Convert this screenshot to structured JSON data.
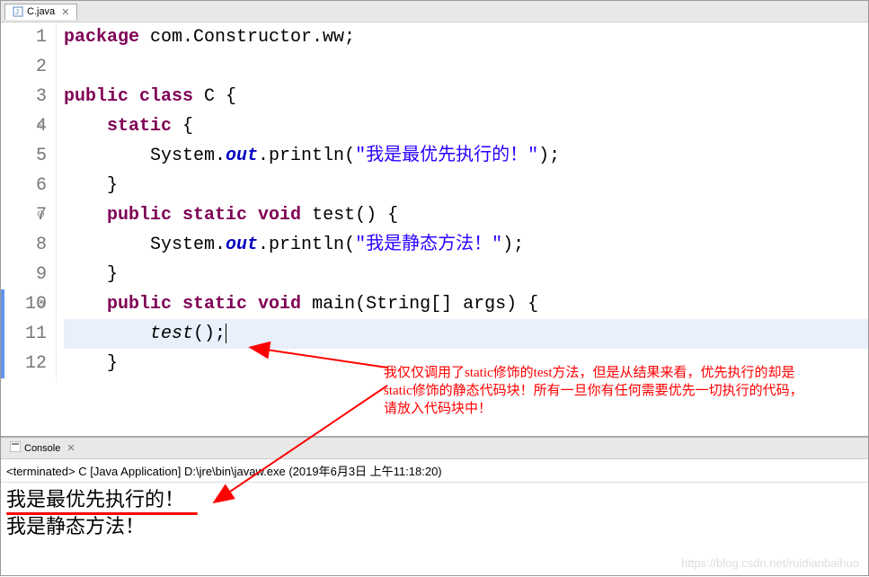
{
  "tab": {
    "filename": "C.java",
    "close": "✕"
  },
  "code": {
    "lines": [
      {
        "n": "1",
        "tokens": [
          {
            "t": "package ",
            "c": "kw"
          },
          {
            "t": "com.Constructor.ww;",
            "c": "txt"
          }
        ]
      },
      {
        "n": "2",
        "tokens": []
      },
      {
        "n": "3",
        "tokens": [
          {
            "t": "public class ",
            "c": "kw"
          },
          {
            "t": "C {",
            "c": "txt"
          }
        ]
      },
      {
        "n": "4",
        "fold": true,
        "tokens": [
          {
            "t": "    ",
            "c": "txt"
          },
          {
            "t": "static",
            "c": "kw"
          },
          {
            "t": " {",
            "c": "txt"
          }
        ]
      },
      {
        "n": "5",
        "tokens": [
          {
            "t": "        System.",
            "c": "txt"
          },
          {
            "t": "out",
            "c": "static-field"
          },
          {
            "t": ".println(",
            "c": "txt"
          },
          {
            "t": "\"我是最优先执行的！\"",
            "c": "str"
          },
          {
            "t": ");",
            "c": "txt"
          }
        ]
      },
      {
        "n": "6",
        "tokens": [
          {
            "t": "    }",
            "c": "txt"
          }
        ]
      },
      {
        "n": "7",
        "fold": true,
        "tokens": [
          {
            "t": "    ",
            "c": "txt"
          },
          {
            "t": "public static void",
            "c": "kw"
          },
          {
            "t": " test() {",
            "c": "txt"
          }
        ]
      },
      {
        "n": "8",
        "tokens": [
          {
            "t": "        System.",
            "c": "txt"
          },
          {
            "t": "out",
            "c": "static-field"
          },
          {
            "t": ".println(",
            "c": "txt"
          },
          {
            "t": "\"我是静态方法！\"",
            "c": "str"
          },
          {
            "t": ");",
            "c": "txt"
          }
        ]
      },
      {
        "n": "9",
        "tokens": [
          {
            "t": "    }",
            "c": "txt"
          }
        ]
      },
      {
        "n": "10",
        "fold": true,
        "hl": true,
        "tokens": [
          {
            "t": "    ",
            "c": "txt"
          },
          {
            "t": "public static void",
            "c": "kw"
          },
          {
            "t": " main(String[] args) {",
            "c": "txt"
          }
        ]
      },
      {
        "n": "11",
        "current": true,
        "hl": true,
        "tokens": [
          {
            "t": "        ",
            "c": "txt"
          },
          {
            "t": "test",
            "c": "method-call"
          },
          {
            "t": "();",
            "c": "txt"
          }
        ],
        "cursor": true
      },
      {
        "n": "12",
        "hl": true,
        "tokens": [
          {
            "t": "    }",
            "c": "txt"
          }
        ]
      }
    ]
  },
  "annotation": {
    "text": "我仅仅调用了static修饰的test方法，但是从结果来看，优先执行的却是static修饰的静态代码块！所有一旦你有任何需要优先一切执行的代码，请放入代码块中！"
  },
  "console": {
    "title": "Console",
    "close": "✕",
    "status": "<terminated> C [Java Application] D:\\jre\\bin\\javaw.exe (2019年6月3日 上午11:18:20)",
    "output": [
      "我是最优先执行的！",
      "我是静态方法！"
    ]
  },
  "watermark": "https://blog.csdn.net/ruidianbaihuo"
}
